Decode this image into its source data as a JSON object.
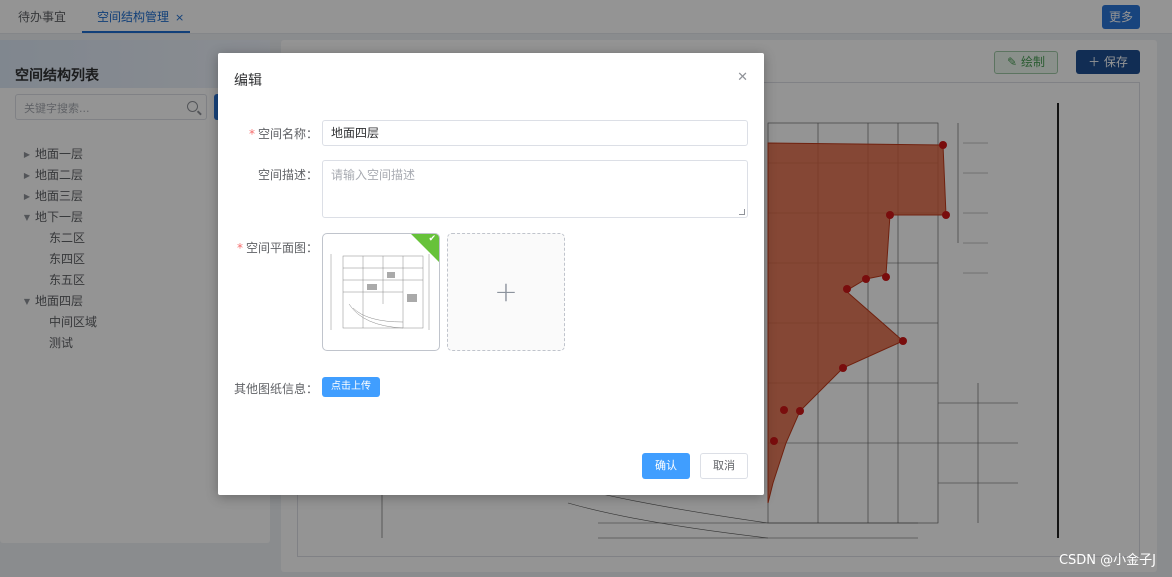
{
  "tabs": [
    {
      "label": "待办事宜"
    },
    {
      "label": "空间结构管理"
    }
  ],
  "tab_close_symbol": "×",
  "more_button": "更多",
  "left_panel": {
    "title": "空间结构列表",
    "search_placeholder": "关键字搜索...",
    "tree": [
      {
        "label": "地面一层"
      },
      {
        "label": "地面二层"
      },
      {
        "label": "地面三层"
      },
      {
        "label": "地下一层"
      },
      {
        "label": "东二区"
      },
      {
        "label": "东四区"
      },
      {
        "label": "东五区"
      },
      {
        "label": "地面四层"
      },
      {
        "label": "中间区域"
      },
      {
        "label": "测试"
      }
    ]
  },
  "toolbar": {
    "draw_label": "绘制",
    "save_label": "保存"
  },
  "dialog": {
    "title": "编辑",
    "required_mark": "*",
    "name_label": "空间名称：",
    "name_value": "地面四层",
    "desc_label": "空间描述：",
    "desc_placeholder": "请输入空间描述",
    "plan_label": "空间平面图：",
    "other_label": "其他图纸信息：",
    "upload_label": "点击上传",
    "ok_label": "确认",
    "cancel_label": "取消"
  },
  "watermark": "CSDN @小金子J",
  "colors": {
    "primary": "#409eff",
    "brand_blue": "#2a75d8",
    "success": "#67c23a",
    "danger": "#f56c6c",
    "polygon_fill": "#e0643f"
  },
  "icons": [
    "close-icon",
    "search-icon",
    "pencil-icon",
    "plus-icon",
    "check-icon",
    "caret-right-icon",
    "caret-down-icon"
  ]
}
